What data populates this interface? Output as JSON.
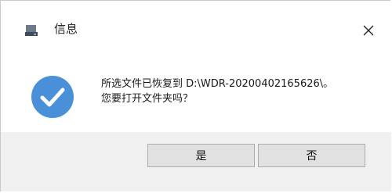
{
  "dialog": {
    "title": "信息",
    "icon": "app-drive-icon",
    "message_line1": "所选文件已恢复到 D:\\WDR-20200402165626\\。",
    "message_line2": "您要打开文件夹吗？",
    "status_icon": "check-circle-icon",
    "buttons": {
      "yes_label": "是",
      "no_label": "否"
    }
  },
  "colors": {
    "accent": "#4a90d9",
    "titlebar": "#ffffff",
    "footer": "#f0f0f0",
    "button": "#e1e1e1"
  }
}
